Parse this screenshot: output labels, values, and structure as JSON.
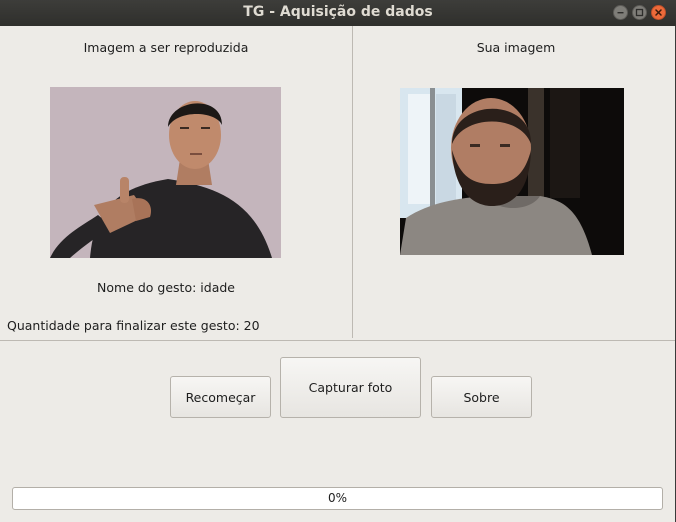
{
  "window": {
    "title": "TG - Aquisição de dados",
    "controls": {
      "minimize_icon": "minimize-icon",
      "maximize_icon": "maximize-icon",
      "close_icon": "close-icon"
    }
  },
  "left_panel": {
    "title": "Imagem a ser reproduzida",
    "gesture_label": "Nome do gesto: idade",
    "remaining_label": "Quantidade para finalizar este gesto: 20"
  },
  "right_panel": {
    "title": "Sua imagem"
  },
  "buttons": {
    "restart": "Recomeçar",
    "capture": "Capturar foto",
    "about": "Sobre"
  },
  "progress": {
    "value": 0,
    "text": "0%"
  },
  "colors": {
    "titlebar": "#3a3a37",
    "window_bg": "#edebe7",
    "close_button": "#ed6a3a",
    "progress_accent": "#e95420"
  }
}
